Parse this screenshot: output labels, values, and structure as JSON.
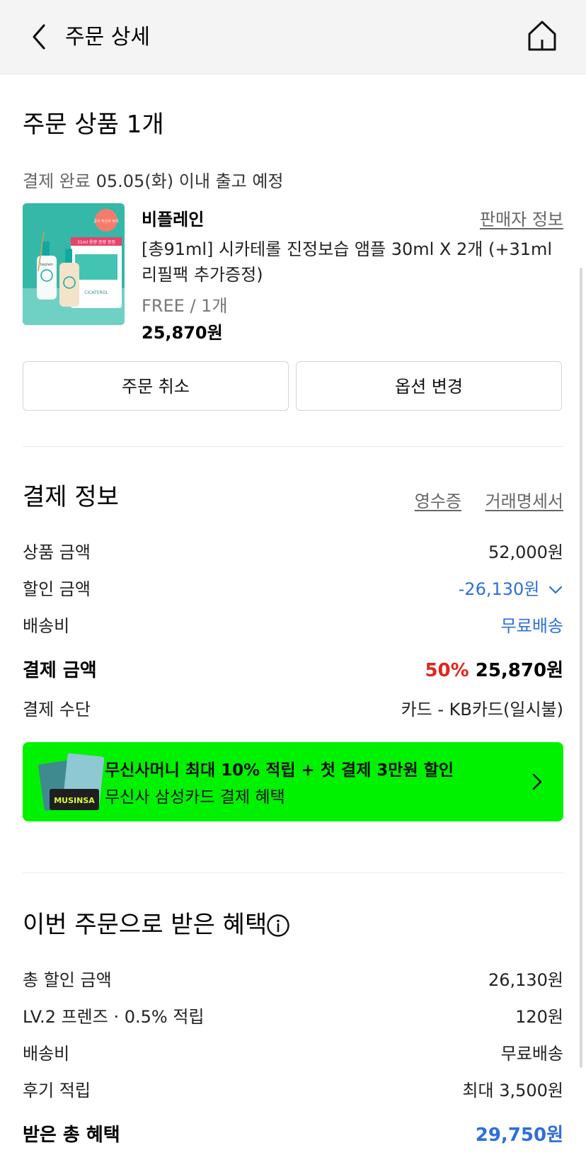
{
  "header": {
    "title": "주문 상세",
    "back_icon": "chevron-left-icon",
    "home_icon": "home-icon"
  },
  "order": {
    "section_title": "주문 상품 1개",
    "status_label": "결제 완료",
    "shipping_note": "05.05(화) 이내 출고 예정",
    "product": {
      "brand": "비플레인",
      "seller_link": "판매자 정보",
      "name": "[총91ml] 시카테롤 진정보습 앰플 30ml X 2개 (+31ml 리필팩 추가증정)",
      "option": "FREE / 1개",
      "price": "25,870원",
      "image_badge": "공식 무신사 뷰티",
      "image_card_text": "31ml 용량 증량 증정",
      "image_bottle_text": "beplain",
      "image_pack_text": "CICATEROL"
    },
    "cancel_button": "주문 취소",
    "option_button": "옵션 변경"
  },
  "payment": {
    "section_title": "결제 정보",
    "receipt_link": "영수증",
    "statement_link": "거래명세서",
    "rows": {
      "product_amount": {
        "label": "상품 금액",
        "value": "52,000원"
      },
      "discount_amount": {
        "label": "할인 금액",
        "value": "-26,130원"
      },
      "shipping": {
        "label": "배송비",
        "value": "무료배송"
      },
      "total": {
        "label": "결제 금액",
        "percent": "50%",
        "value": "25,870원"
      },
      "method": {
        "label": "결제 수단",
        "value": "카드 - KB카드(일시불)"
      }
    }
  },
  "banner": {
    "title": "무신사머니 최대 10% 적립 + 첫 결제 3만원 할인",
    "subtitle": "무신사 삼성카드 결제 혜택",
    "card_text": "MUSINSA",
    "background": "#00f200"
  },
  "benefits": {
    "section_title": "이번 주문으로 받은 혜택",
    "info_icon": "info-icon",
    "rows": {
      "total_discount": {
        "label": "총 할인 금액",
        "value": "26,130원"
      },
      "level_reward": {
        "label": "LV.2 프렌즈 · 0.5% 적립",
        "value": "120원"
      },
      "shipping": {
        "label": "배송비",
        "value": "무료배송"
      },
      "review": {
        "label": "후기 적립",
        "value": "최대 3,500원"
      },
      "received_total": {
        "label": "받은 총 혜택",
        "value": "29,750원"
      }
    }
  },
  "colors": {
    "accent_blue": "#2f6fdb",
    "discount_red": "#e1251b",
    "header_bg": "#f4f4f4"
  }
}
